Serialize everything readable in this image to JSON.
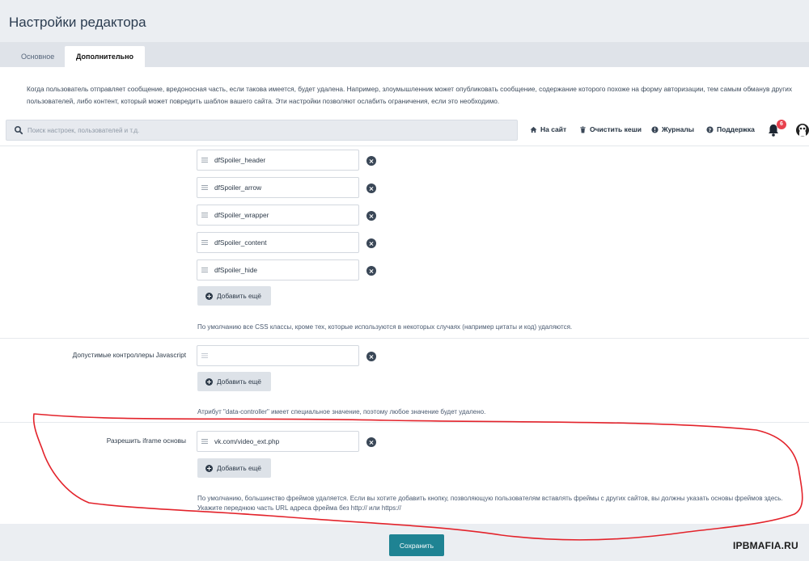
{
  "page": {
    "title": "Настройки редактора"
  },
  "tabs": [
    {
      "label": "Основное",
      "active": false
    },
    {
      "label": "Дополнительно",
      "active": true
    }
  ],
  "description": "Когда пользователь отправляет сообщение, вредоносная часть, если такова имеется, будет удалена. Например, злоумышленник может опубликовать сообщение, содержание которого похоже на форму авторизации, тем самым обманув других пользователей, либо контент, который может повредить шаблон вашего сайта. Эти настройки позволяют ослабить ограничения, если это необходимо.",
  "topbar": {
    "search_placeholder": "Поиск настроек, пользователей и т.д.",
    "links": {
      "site": "На сайт",
      "clear_cache": "Очистить кеши",
      "logs": "Журналы",
      "support": "Поддержка"
    },
    "notifications_count": "6"
  },
  "css_classes": {
    "items": [
      "dfSpoiler_header",
      "dfSpoiler_arrow",
      "dfSpoiler_wrapper",
      "dfSpoiler_content",
      "dfSpoiler_hide"
    ],
    "add_label": "Добавить ещё",
    "note": "По умолчанию все CSS классы, кроме тех, которые используются в некоторых случаях (например цитаты и код) удаляются."
  },
  "js_controllers": {
    "label": "Допустимые контроллеры Javascript",
    "value": "",
    "add_label": "Добавить ещё",
    "note": "Атрибут \"data-controller\" имеет специальное значение, поэтому любое значение будет удалено."
  },
  "iframe_bases": {
    "label": "Разрешить iframe основы",
    "value": "vk.com/video_ext.php",
    "add_label": "Добавить ещё",
    "note_line1": "По умолчанию, большинство фреймов удаляется. Если вы хотите добавить кнопку, позволяющую пользователям вставлять фреймы с других сайтов, вы должны указать основы фреймов здесь.",
    "note_line2": "Укажите переднюю часть URL адреса фрейма без http:// или https://"
  },
  "footer": {
    "save_label": "Сохранить"
  },
  "watermark": "IPBMAFIA.RU",
  "colors": {
    "primary_button": "#1f8393",
    "annotation": "#e3232b",
    "badge": "#e8414d"
  }
}
